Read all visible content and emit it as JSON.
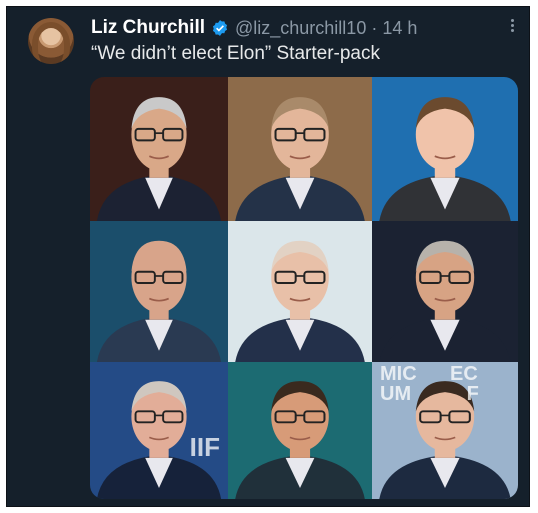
{
  "tweet": {
    "author_name": "Liz Churchill",
    "handle": "@liz_churchill10",
    "separator": "·",
    "time": "14 h",
    "text": "“We didn’t elect Elon” Starter-pack"
  },
  "icons": {
    "verified": "verified-badge-icon",
    "more": "more-options-icon"
  },
  "colors": {
    "background": "#15202b",
    "verified": "#1d9bf0",
    "secondary_text": "#8b98a5"
  },
  "media": {
    "rows": 3,
    "columns": 3,
    "cells": [
      {
        "bg": "#3a1f1a",
        "suit": "#1c2233",
        "skin": "#d9a888",
        "hair": "#c9c9c9",
        "glasses": true
      },
      {
        "bg": "#8d6b4a",
        "suit": "#243248",
        "skin": "#e3b69a",
        "hair": "#a98a6a",
        "glasses": true
      },
      {
        "bg": "#1f6fb0",
        "suit": "#303236",
        "skin": "#f0c3aa",
        "hair": "#6b4a2e",
        "glasses": false
      },
      {
        "bg": "#1b4e6b",
        "suit": "#2a3a52",
        "skin": "#d8a48a",
        "hair": "#d8a48a",
        "glasses": true
      },
      {
        "bg": "#dbe6ea",
        "suit": "#23304a",
        "skin": "#e8c0a8",
        "hair": "#e2d2c4",
        "glasses": true
      },
      {
        "bg": "#1b2232",
        "suit": "#1b2232",
        "skin": "#d7a384",
        "hair": "#b7b2ab",
        "glasses": true
      },
      {
        "bg": "#244b86",
        "suit": "#16223a",
        "skin": "#e2ad98",
        "hair": "#cfc7bf",
        "glasses": true
      },
      {
        "bg": "#1c6b72",
        "suit": "#20303a",
        "skin": "#d79b78",
        "hair": "#3a2a1e",
        "glasses": true
      },
      {
        "bg": "#9bb3cc",
        "suit": "#1d2a40",
        "skin": "#e6b89e",
        "hair": "#3a2a20",
        "glasses": true
      }
    ],
    "background_text": [
      "MIC",
      "UM",
      "EC",
      "F",
      "IIF"
    ]
  }
}
